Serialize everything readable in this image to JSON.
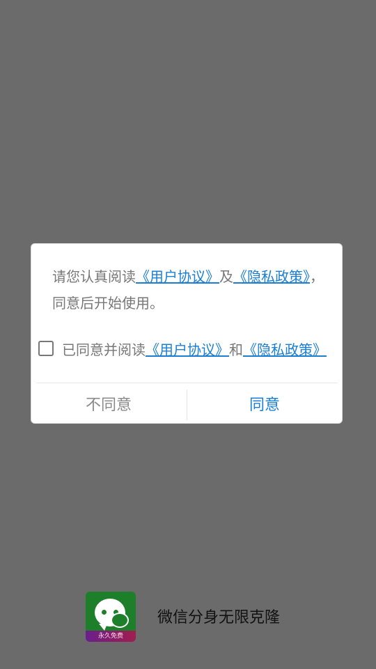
{
  "dialog": {
    "message_prefix": "请您认真阅读",
    "user_agreement_link": "《用户协议》",
    "conj": "及",
    "privacy_link": "《隐私政策》",
    "message_suffix": "，同意后开始使用。",
    "checkbox_prefix": "已同意并阅读",
    "checkbox_user_agreement": "《用户协议》",
    "checkbox_and": "和",
    "checkbox_privacy": "《隐私政策》",
    "checkbox_checked": false,
    "disagree_label": "不同意",
    "agree_label": "同意"
  },
  "app": {
    "name": "微信分身无限克隆",
    "icon_badge": "永久免费"
  },
  "colors": {
    "link": "#1a7fd4",
    "overlay": "#6b6b6b",
    "icon_green": "#1e7f2a"
  }
}
